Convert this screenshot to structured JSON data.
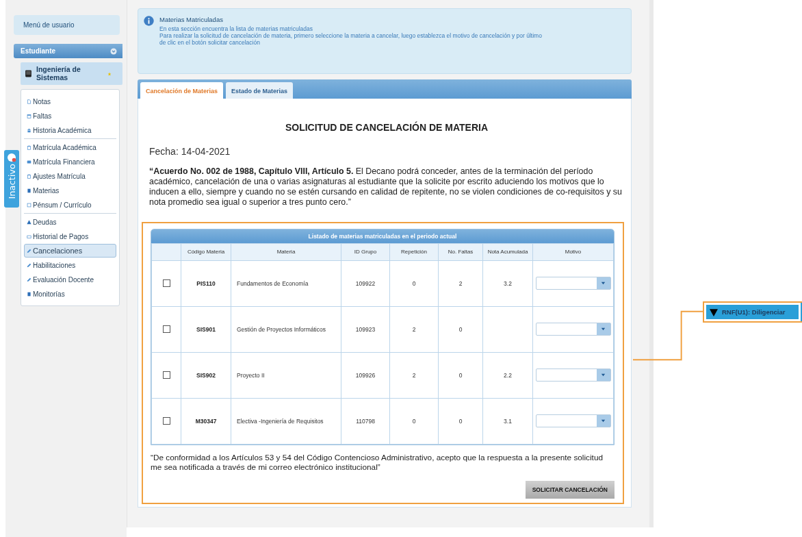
{
  "sidebar": {
    "user_menu": "Menú de usuario",
    "role": {
      "label": "Estudiante",
      "expanded": true
    },
    "program": {
      "label": "Ingeniería de Sistemas"
    },
    "menu_groups": [
      {
        "items": [
          {
            "label": "Notas",
            "selected": false
          },
          {
            "label": "Faltas",
            "selected": false
          },
          {
            "label": "Historia Académica",
            "selected": false
          }
        ]
      },
      {
        "items": [
          {
            "label": "Matrícula Académica",
            "selected": false
          },
          {
            "label": "Matrícula Financiera",
            "selected": false
          },
          {
            "label": "Ajustes Matrícula",
            "selected": false
          },
          {
            "label": "Materias",
            "selected": false
          },
          {
            "label": "Pénsum / Currículo",
            "selected": false
          }
        ]
      },
      {
        "items": [
          {
            "label": "Deudas",
            "selected": false
          },
          {
            "label": "Historial de Pagos",
            "selected": false
          },
          {
            "label": "Cancelaciones",
            "selected": true
          },
          {
            "label": "Habilitaciones",
            "selected": false
          },
          {
            "label": "Evaluación Docente",
            "selected": false
          },
          {
            "label": "Monitorías",
            "selected": false
          }
        ]
      }
    ]
  },
  "status_tab": {
    "label": "Inactivo"
  },
  "info": {
    "title": "Materias Matriculadas",
    "lines": [
      "En esta sección encuentra la lista de materias matriculadas",
      "Para realizar la solicitud de cancelación de materia, primero seleccione la materia a cancelar, luego establezca el motivo de cancelación y por último",
      "de clic en el botón solicitar cancelación"
    ]
  },
  "tabs": [
    {
      "label": "Cancelación de Materias",
      "selected": true
    },
    {
      "label": "Estado de Materias",
      "selected": false
    }
  ],
  "form": {
    "title": "SOLICITUD DE CANCELACIÓN DE MATERIA",
    "date": "Fecha: 14-04-2021",
    "regulation": "**“Acuerdo No. 002 de 1988, Capítulo VIII, Artículo 5.**  El Decano podrá conceder, antes de la terminación del período académico, cancelación de una o varias asignaturas al estudiante que la solicite por escrito aduciendo los motivos que lo inducen a ello, siempre y cuando no se estén cursando en calidad de repitente, no se violen condiciones de co-requisitos y su nota promedio sea igual o superior a tres punto cero.”",
    "table": {
      "caption": "Listado de materias matriculadas en el periodo actual",
      "columns": [
        "Código Materia",
        "Materia",
        "ID Grupo",
        "Repetición",
        "No. Faltas",
        "Nota Acumulada",
        "Motivo"
      ],
      "rows": [
        {
          "checked": false,
          "code": "PIS110",
          "subject": "Fundamentos de Economía",
          "group": "109922",
          "repetition": "0",
          "absences": "2",
          "grade": "3.2"
        },
        {
          "checked": false,
          "code": "SIS901",
          "subject": "Gestión de Proyectos Informáticos",
          "group": "109923",
          "repetition": "2",
          "absences": "0"
        },
        {
          "checked": false,
          "code": "SIS902",
          "subject": "Proyecto II",
          "group": "109926",
          "repetition": "2",
          "absences": "0",
          "grade": "2.2"
        },
        {
          "checked": false,
          "code": "M30347",
          "subject": "Electiva -Ingeniería de Requisitos",
          "group": "110798",
          "repetition": "0",
          "absences": "0",
          "grade": "3.1"
        }
      ]
    },
    "consent": "“De conformidad a los Artículos 53 y 54 del Código Contencioso Administrativo, acepto que la respuesta a la presente solicitud me sea notificada a través de mi correo electrónico institucional”",
    "submit": "SOLICITAR CANCELACIÓN"
  },
  "annotation": {
    "label": "RNF(U1): Diligenciar"
  }
}
